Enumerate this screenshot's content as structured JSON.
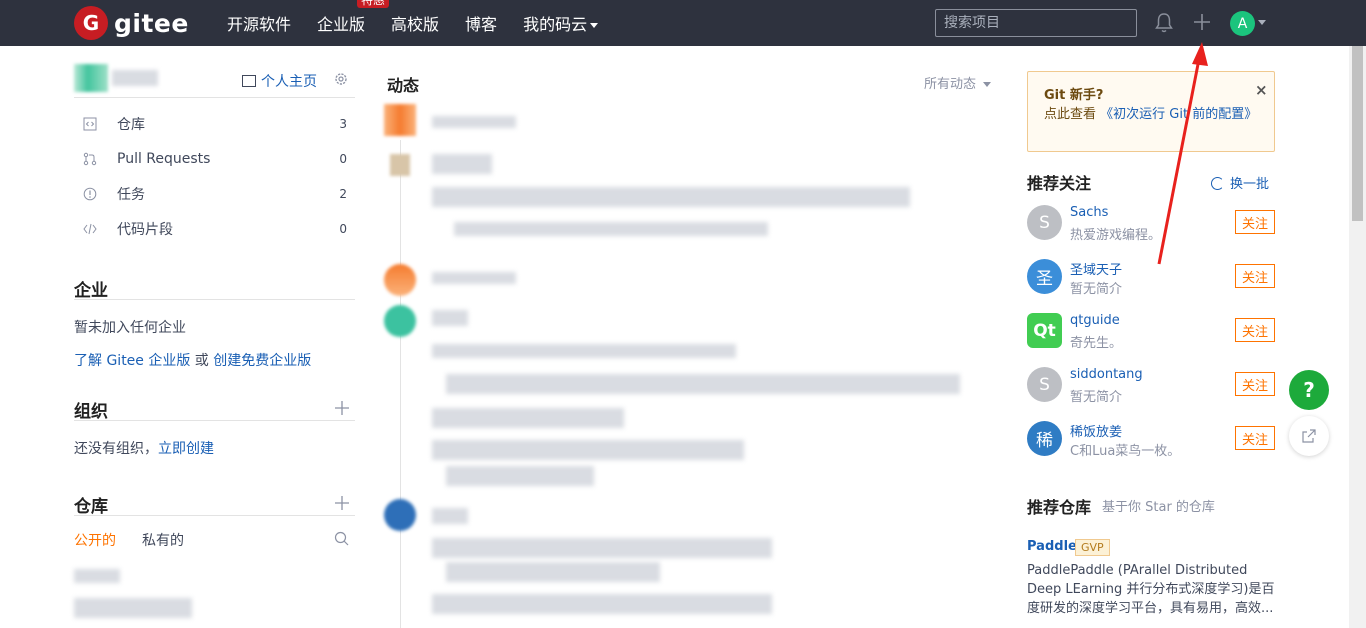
{
  "header": {
    "logo_text": "gitee",
    "logo_mark": "G",
    "nav": [
      "开源软件",
      "企业版",
      "高校版",
      "博客",
      "我的码云"
    ],
    "nav_badge": "特惠",
    "search_placeholder": "搜索项目",
    "avatar_letter": "A",
    "icons": [
      "bell-icon",
      "plus-icon",
      "chevron-down-icon"
    ]
  },
  "left": {
    "home_link": "个人主页",
    "menu": [
      {
        "label": "仓库",
        "count": "3",
        "icon": "code-icon"
      },
      {
        "label": "Pull Requests",
        "count": "0",
        "icon": "pull-request-icon"
      },
      {
        "label": "任务",
        "count": "2",
        "icon": "issue-icon"
      },
      {
        "label": "代码片段",
        "count": "0",
        "icon": "snippet-icon"
      }
    ],
    "enterprise": {
      "title": "企业",
      "empty_text": "暂未加入任何企业",
      "learn_link": "了解 Gitee 企业版",
      "or_text": " 或 ",
      "create_link": "创建免费企业版"
    },
    "orgs": {
      "title": "组织",
      "empty_text": "还没有组织，",
      "create_link": "立即创建"
    },
    "repos": {
      "title": "仓库",
      "tab_public": "公开的",
      "tab_private": "私有的"
    }
  },
  "feed": {
    "title": "动态",
    "filter": "所有动态"
  },
  "right": {
    "tip": {
      "title": "Git 新手?",
      "text_prefix": "点此查看 ",
      "link": "《初次运行 Git 前的配置》",
      "close": "×"
    },
    "recommend_title": "推荐关注",
    "refresh": "换一批",
    "follow_label": "关注",
    "users": [
      {
        "avatar": "S",
        "name": "Sachs",
        "desc": "热爱游戏编程。",
        "color": "#bdbfc4"
      },
      {
        "avatar": "圣",
        "name": "圣域天子",
        "desc": "暂无简介",
        "color": "#3b8ed9"
      },
      {
        "avatar": "Qt",
        "name": "qtguide",
        "desc": "奇先生。",
        "color": "#41cd52"
      },
      {
        "avatar": "S",
        "name": "siddontang",
        "desc": "暂无简介",
        "color": "#bdbfc4"
      },
      {
        "avatar": "稀",
        "name": "稀饭放姜",
        "desc": "C和Lua菜鸟一枚。",
        "color": "#2f7cc4"
      }
    ],
    "repo_section_title": "推荐仓库",
    "repo_section_sub": "基于你 Star 的仓库",
    "repo": {
      "name": "Paddle",
      "badge": "GVP",
      "desc": "PaddlePaddle (PArallel Distributed Deep LEarning 并行分布式深度学习)是百度研发的深度学习平台，具有易用，高效..."
    }
  },
  "floating": {
    "help": "?"
  },
  "colors": {
    "topbar": "#2e323e",
    "accent": "#fe7300",
    "link": "#1a5fb4",
    "help_green": "#1daa3b",
    "annotation_red": "#e8211d"
  }
}
